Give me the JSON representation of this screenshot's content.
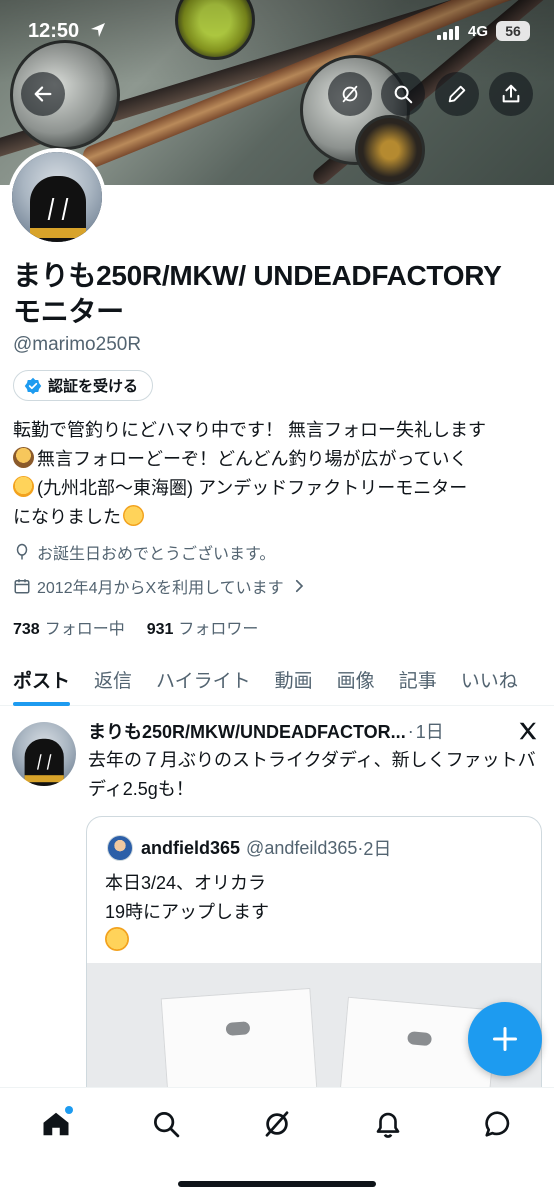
{
  "status_bar": {
    "time": "12:50",
    "network": "4G",
    "battery": "56"
  },
  "profile": {
    "name": "まりも250R/MKW/ UNDEADFACTORY モニター",
    "handle": "@marimo250R",
    "verify_label": "認証を受ける",
    "bio": {
      "line1": "転勤で管釣りにどハマり中です！ 無言フォロー失礼します",
      "line2": "無言フォローどーぞ！どんどん釣り場が広がっていく",
      "line3": "(九州北部〜東海圏) アンデッドファクトリーモニター",
      "line4": "になりました"
    },
    "birthday_text": "お誕生日おめでとうございます。",
    "joined_text": "2012年4月からXを利用しています",
    "following_count": "738",
    "following_label": "フォロー中",
    "followers_count": "931",
    "followers_label": "フォロワー"
  },
  "tabs": [
    {
      "label": "ポスト"
    },
    {
      "label": "返信"
    },
    {
      "label": "ハイライト"
    },
    {
      "label": "動画"
    },
    {
      "label": "画像"
    },
    {
      "label": "記事"
    },
    {
      "label": "いいね"
    }
  ],
  "post": {
    "author": "まりも250R/MKW/UNDEADFACTOR...",
    "separator": "·",
    "time": "1日",
    "text": "去年の７月ぶりのストライクダディ、新しくファットバディ2.5gも！",
    "quote": {
      "name": "andfield365",
      "handle": "@andfeild365",
      "separator": "·",
      "time": "2日",
      "line1": "本日3/24、オリカラ",
      "line2": "19時にアップします"
    }
  },
  "colors": {
    "accent": "#1d9bf0",
    "text": "#0f1419",
    "muted": "#536471",
    "border": "#cfd9de"
  },
  "icons": {
    "header_buttons": [
      "back-arrow-icon",
      "grok-icon",
      "search-icon",
      "edit-icon",
      "share-icon"
    ],
    "bottom_nav": [
      "home-icon",
      "search-icon",
      "grok-icon",
      "notifications-icon",
      "messages-icon"
    ]
  }
}
